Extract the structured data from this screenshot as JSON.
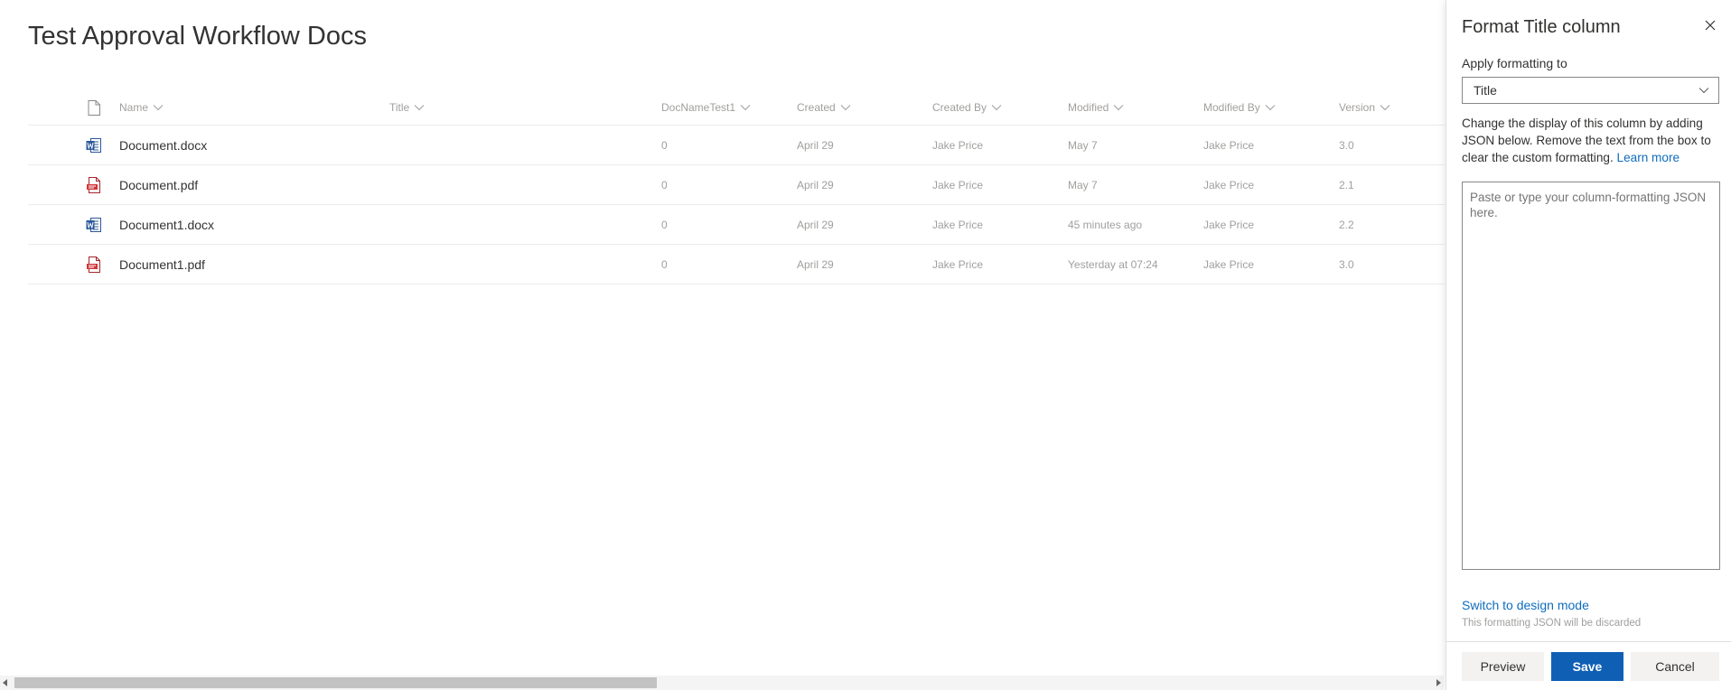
{
  "library": {
    "title": "Test Approval Workflow Docs",
    "columns": {
      "name": "Name",
      "title": "Title",
      "docname": "DocNameTest1",
      "created": "Created",
      "created_by": "Created By",
      "modified": "Modified",
      "modified_by": "Modified By",
      "version": "Version"
    },
    "rows": [
      {
        "icon": "word-doc-icon",
        "name": "Document.docx",
        "title": "",
        "docname": "0",
        "created": "April 29",
        "created_by": "Jake Price",
        "modified": "May 7",
        "modified_by": "Jake Price",
        "version": "3.0"
      },
      {
        "icon": "pdf-doc-icon",
        "name": "Document.pdf",
        "title": "",
        "docname": "0",
        "created": "April 29",
        "created_by": "Jake Price",
        "modified": "May 7",
        "modified_by": "Jake Price",
        "version": "2.1"
      },
      {
        "icon": "word-doc-icon",
        "name": "Document1.docx",
        "title": "",
        "docname": "0",
        "created": "April 29",
        "created_by": "Jake Price",
        "modified": "45 minutes ago",
        "modified_by": "Jake Price",
        "version": "2.2"
      },
      {
        "icon": "pdf-doc-icon",
        "name": "Document1.pdf",
        "title": "",
        "docname": "0",
        "created": "April 29",
        "created_by": "Jake Price",
        "modified": "Yesterday at 07:24",
        "modified_by": "Jake Price",
        "version": "3.0"
      }
    ]
  },
  "panel": {
    "title": "Format Title column",
    "apply_label": "Apply formatting to",
    "apply_value": "Title",
    "description": "Change the display of this column by adding JSON below. Remove the text from the box to clear the custom formatting.",
    "learn_more": "Learn more",
    "json_placeholder": "Paste or type your column-formatting JSON here.",
    "json_value": "",
    "design_mode_link": "Switch to design mode",
    "discard_note": "This formatting JSON will be discarded",
    "preview_label": "Preview",
    "save_label": "Save",
    "cancel_label": "Cancel"
  },
  "colors": {
    "accent": "#0f5fb5",
    "link": "#0f6cbd",
    "word_blue": "#2b579a",
    "pdf_red": "#d13438"
  }
}
